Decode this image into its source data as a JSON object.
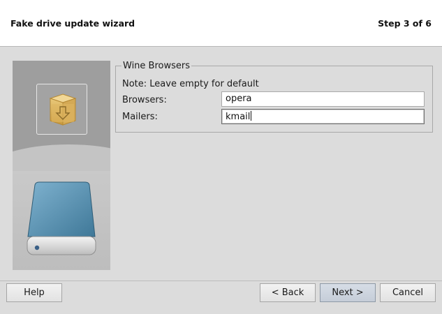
{
  "header": {
    "title": "Fake drive update wizard",
    "step": "Step 3 of 6"
  },
  "sidebar": {
    "top_icon": "package-download-icon",
    "bottom_icon": "hard-drive-icon"
  },
  "group": {
    "legend": "Wine Browsers",
    "note": "Note: Leave empty for default",
    "fields": [
      {
        "label": "Browsers:",
        "value": "opera"
      },
      {
        "label": "Mailers:",
        "value": "kmail",
        "focused": true
      }
    ]
  },
  "buttons": {
    "help": "Help",
    "back": "< Back",
    "next": "Next >",
    "cancel": "Cancel"
  },
  "colors": {
    "header_bg": "#ffffff",
    "body_bg": "#dcdcdc",
    "side_panel_dark": "#9e9e9e",
    "drive_blue": "#5f95b4",
    "next_button": "#c9d1db"
  }
}
